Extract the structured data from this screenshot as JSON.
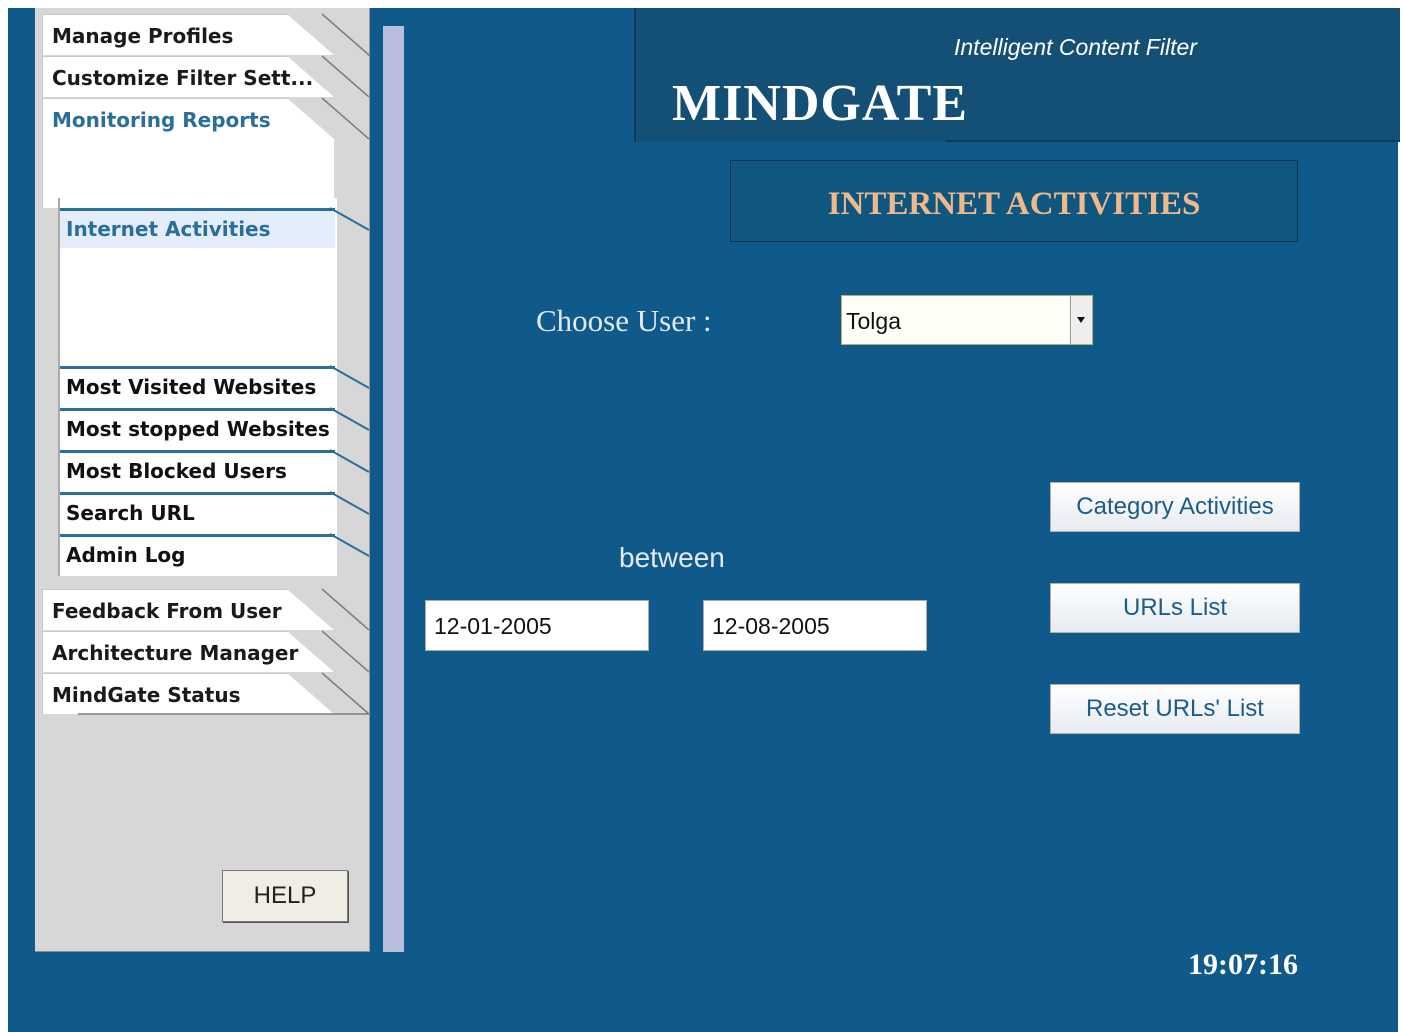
{
  "nav": {
    "items": [
      {
        "label": "Manage Profiles"
      },
      {
        "label": "Customize Filter Sett..."
      },
      {
        "label": "Monitoring Reports"
      },
      {
        "label": "Feedback From User"
      },
      {
        "label": "Architecture Manager"
      },
      {
        "label": "MindGate Status"
      }
    ],
    "active": "Monitoring Reports",
    "sub_items": [
      {
        "label": "Internet Activities"
      },
      {
        "label": "Most Visited Websites"
      },
      {
        "label": "Most stopped Websites"
      },
      {
        "label": "Most Blocked Users"
      },
      {
        "label": "Search URL"
      },
      {
        "label": "Admin Log"
      }
    ],
    "active_sub": "Internet Activities",
    "help_label": "HELP"
  },
  "header": {
    "tagline": "Intelligent Content Filter",
    "title": "MINDGATE",
    "section_title": "INTERNET ACTIVITIES"
  },
  "form": {
    "choose_user_label": "Choose User :",
    "selected_user": "Tolga",
    "between_label": "between",
    "date_from": "12-01-2005",
    "date_to": "12-08-2005"
  },
  "actions": {
    "category_activities": "Category Activities",
    "urls_list": "URLs List",
    "reset_urls_list": "Reset URLs' List"
  },
  "clock": "19:07:16",
  "colors": {
    "background": "#0f5a8a",
    "header": "#145075",
    "section_title": "#f0b98c",
    "button_text": "#1d5c88",
    "active_nav": "#2a6e9a",
    "panel": "#d7d7d7"
  }
}
